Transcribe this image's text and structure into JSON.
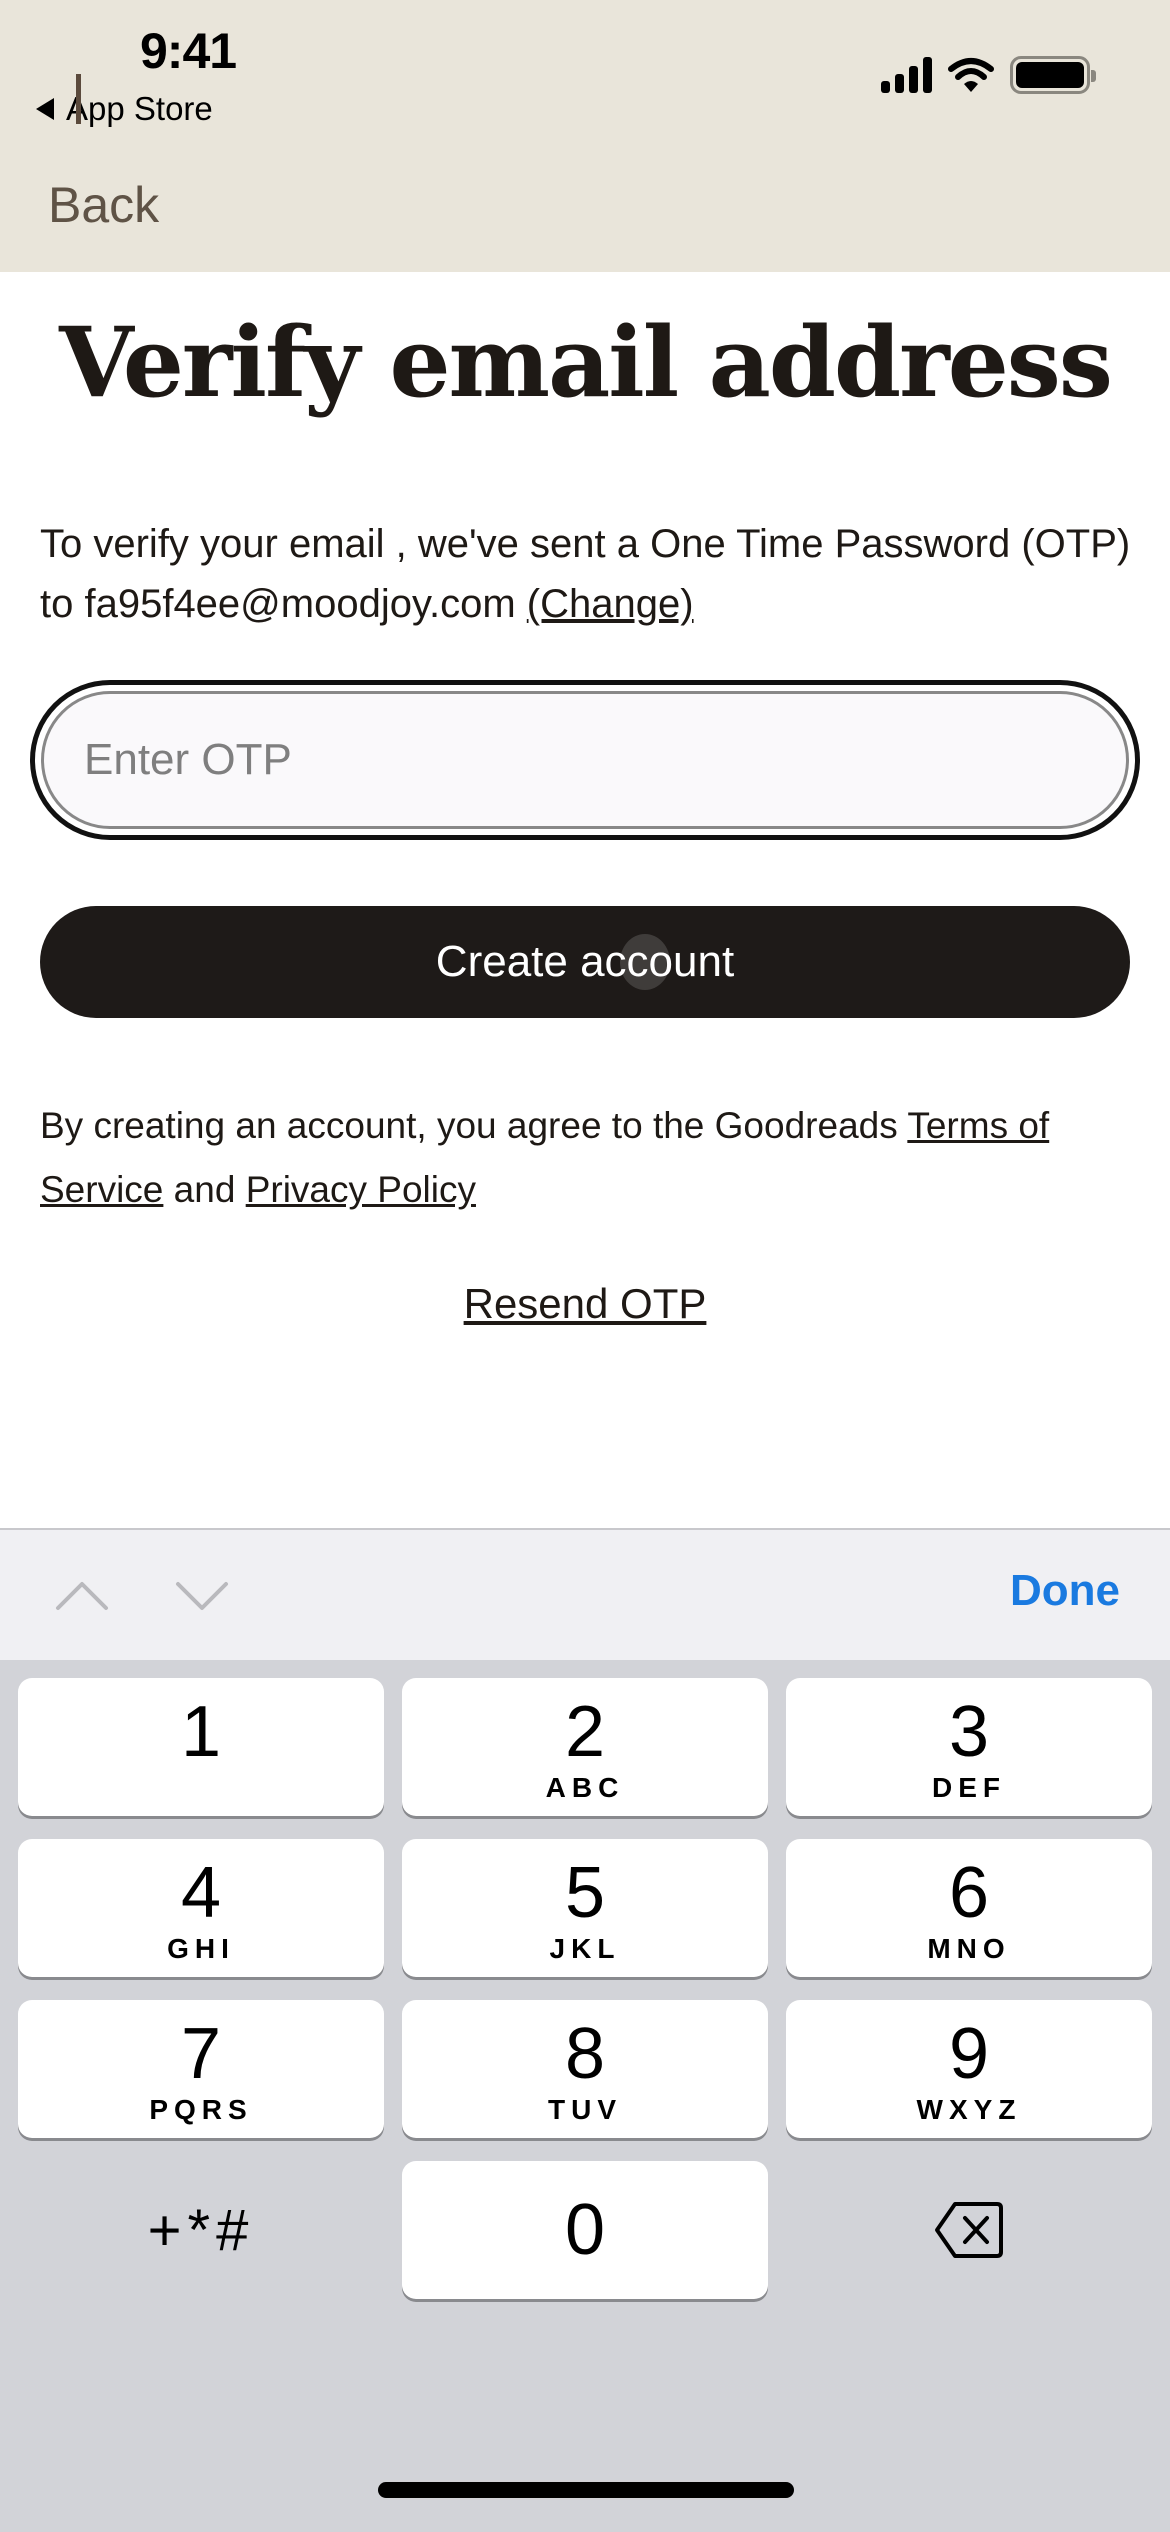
{
  "status_bar": {
    "time": "9:41",
    "back_app": "App Store",
    "icons": [
      "cellular-signal-icon",
      "wifi-icon",
      "battery-icon"
    ]
  },
  "nav": {
    "back_label": "Back"
  },
  "page": {
    "title": "Verify email address",
    "description_prefix": "To verify your email , we've sent a One Time Password (OTP) to fa95f4ee@moodjoy.com ",
    "change_link": "(Change)",
    "otp_input": {
      "value": "",
      "placeholder": "Enter OTP"
    },
    "create_button": "Create account",
    "terms_prefix": "By creating an account, you agree to the Goodreads ",
    "terms_link": "Terms of Service",
    "terms_and": " and ",
    "privacy_link": "Privacy Policy",
    "resend_link": "Resend OTP"
  },
  "keyboard_accessory": {
    "prev_icon": "chevron-up-icon",
    "next_icon": "chevron-down-icon",
    "done_label": "Done"
  },
  "keypad": {
    "keys": [
      {
        "num": "1",
        "letters": ""
      },
      {
        "num": "2",
        "letters": "ABC"
      },
      {
        "num": "3",
        "letters": "DEF"
      },
      {
        "num": "4",
        "letters": "GHI"
      },
      {
        "num": "5",
        "letters": "JKL"
      },
      {
        "num": "6",
        "letters": "MNO"
      },
      {
        "num": "7",
        "letters": "PQRS"
      },
      {
        "num": "8",
        "letters": "TUV"
      },
      {
        "num": "9",
        "letters": "WXYZ"
      },
      {
        "num": "0",
        "letters": ""
      }
    ],
    "symbols_label": "+*#",
    "delete_icon": "backspace-icon"
  },
  "colors": {
    "header_bg": "#e9e5da",
    "primary_button": "#1e1a18",
    "done_blue": "#1a7ae0",
    "keyboard_bg": "#d2d3d8"
  }
}
